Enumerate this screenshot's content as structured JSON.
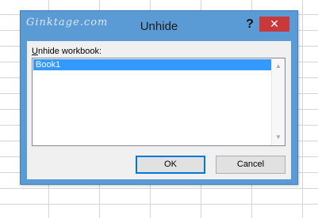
{
  "dialog": {
    "title": "Unhide",
    "watermark": "Ginktage.com",
    "help_label": "?",
    "close_label": "✕",
    "colors": {
      "frame": "#5b9bd5",
      "close": "#c9393a",
      "selection": "#3399ff"
    }
  },
  "form": {
    "list_label_accesskey": "U",
    "list_label_rest": "nhide workbook:",
    "items": [
      "Book1"
    ],
    "selected": "Book1",
    "scroll_up_label": "▲",
    "scroll_down_label": "▼"
  },
  "buttons": {
    "ok": "OK",
    "cancel": "Cancel"
  }
}
